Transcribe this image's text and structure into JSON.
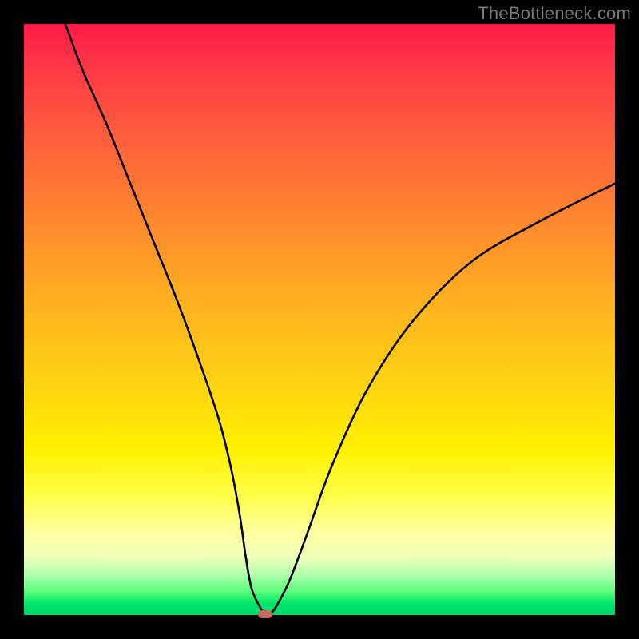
{
  "watermark": "TheBottleneck.com",
  "chart_data": {
    "type": "line",
    "title": "",
    "xlabel": "",
    "ylabel": "",
    "xlim": [
      0,
      100
    ],
    "ylim": [
      0,
      100
    ],
    "grid": false,
    "legend": false,
    "series": [
      {
        "name": "bottleneck-curve",
        "x": [
          7,
          10,
          14,
          18,
          22,
          26,
          30,
          33,
          35,
          36.5,
          37.5,
          38.5,
          40,
          41,
          42,
          43,
          45,
          48,
          52,
          58,
          66,
          76,
          88,
          100
        ],
        "values": [
          100,
          92,
          83,
          73,
          63,
          53,
          42,
          33,
          25,
          17,
          10,
          4.5,
          1.2,
          0.1,
          0.5,
          2,
          6,
          14,
          25,
          38,
          50,
          60,
          67,
          73
        ]
      }
    ],
    "annotations": [
      {
        "name": "min-marker",
        "x": 40.8,
        "y": 0.15
      }
    ],
    "background_gradient": {
      "direction": "vertical",
      "stops": [
        {
          "pos": 0,
          "color": "#ff1a49"
        },
        {
          "pos": 32,
          "color": "#ff8430"
        },
        {
          "pos": 60,
          "color": "#ffd014"
        },
        {
          "pos": 80,
          "color": "#ffff4a"
        },
        {
          "pos": 93,
          "color": "#b6ffb0"
        },
        {
          "pos": 100,
          "color": "#00d66a"
        }
      ]
    }
  }
}
